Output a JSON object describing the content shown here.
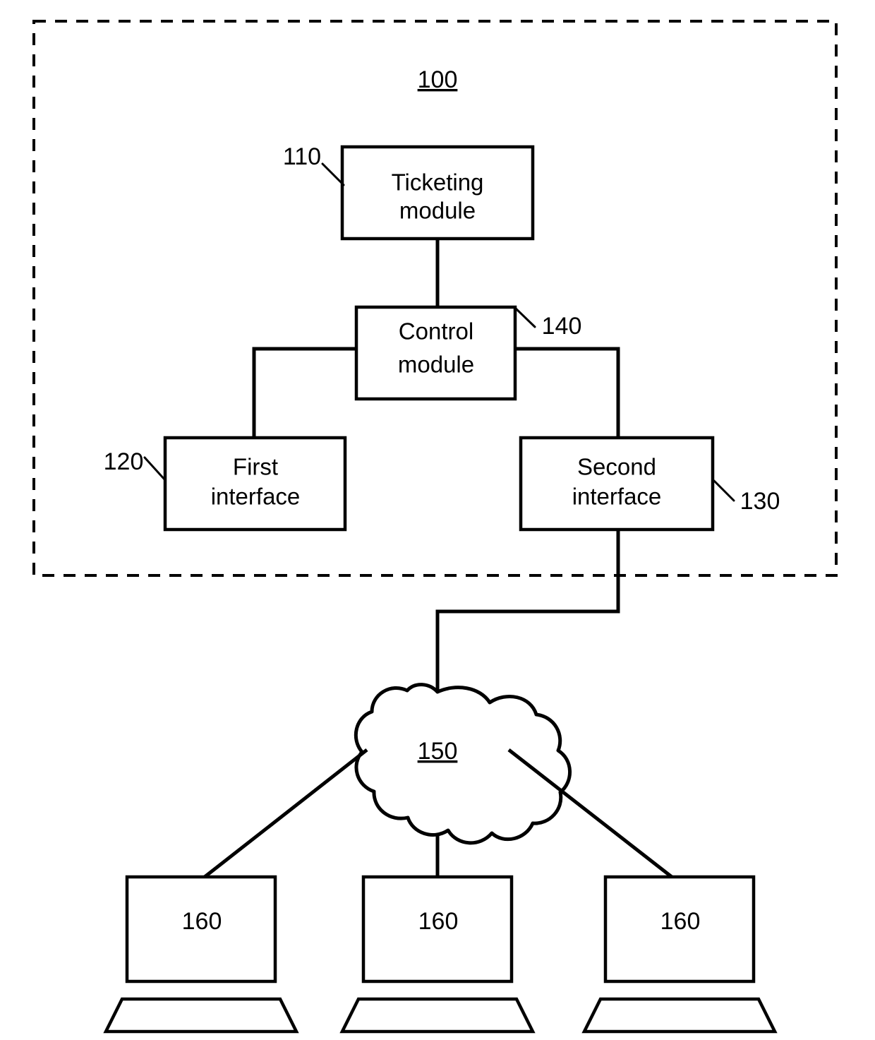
{
  "figure": {
    "system_ref": "100",
    "boundary_style": "dashed"
  },
  "blocks": {
    "ticketing_module": {
      "label_line1": "Ticketing",
      "label_line2": "module",
      "ref": "110"
    },
    "control_module": {
      "label_line1": "Control",
      "label_line2": "module",
      "ref": "140"
    },
    "first_interface": {
      "label_line1": "First",
      "label_line2": "interface",
      "ref": "120"
    },
    "second_interface": {
      "label_line1": "Second",
      "label_line2": "interface",
      "ref": "130"
    },
    "network_cloud": {
      "ref": "150"
    },
    "terminals": [
      {
        "ref": "160"
      },
      {
        "ref": "160"
      },
      {
        "ref": "160"
      }
    ]
  },
  "colors": {
    "stroke": "#000000",
    "fill": "#ffffff"
  }
}
